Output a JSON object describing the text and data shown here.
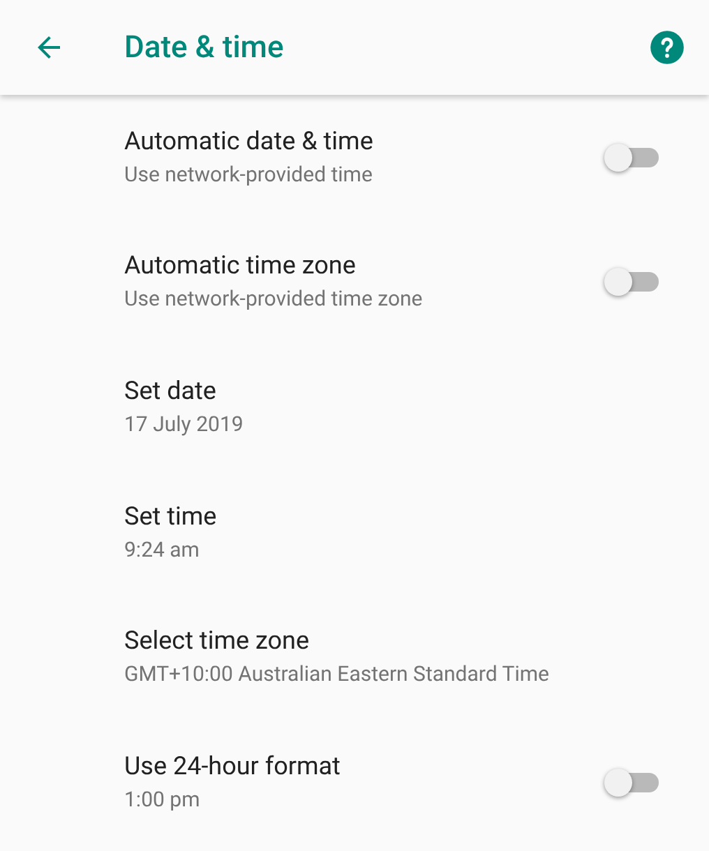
{
  "header": {
    "title": "Date & time"
  },
  "settings": [
    {
      "kind": "toggle",
      "title": "Automatic date & time",
      "summary": "Use network-provided time",
      "on": false
    },
    {
      "kind": "toggle",
      "title": "Automatic time zone",
      "summary": "Use network-provided time zone",
      "on": false
    },
    {
      "kind": "plain",
      "title": "Set date",
      "summary": "17 July 2019"
    },
    {
      "kind": "plain",
      "title": "Set time",
      "summary": "9:24 am"
    },
    {
      "kind": "plain",
      "title": "Select time zone",
      "summary": "GMT+10:00 Australian Eastern Standard Time"
    },
    {
      "kind": "toggle",
      "title": "Use 24-hour format",
      "summary": "1:00 pm",
      "on": false
    }
  ]
}
